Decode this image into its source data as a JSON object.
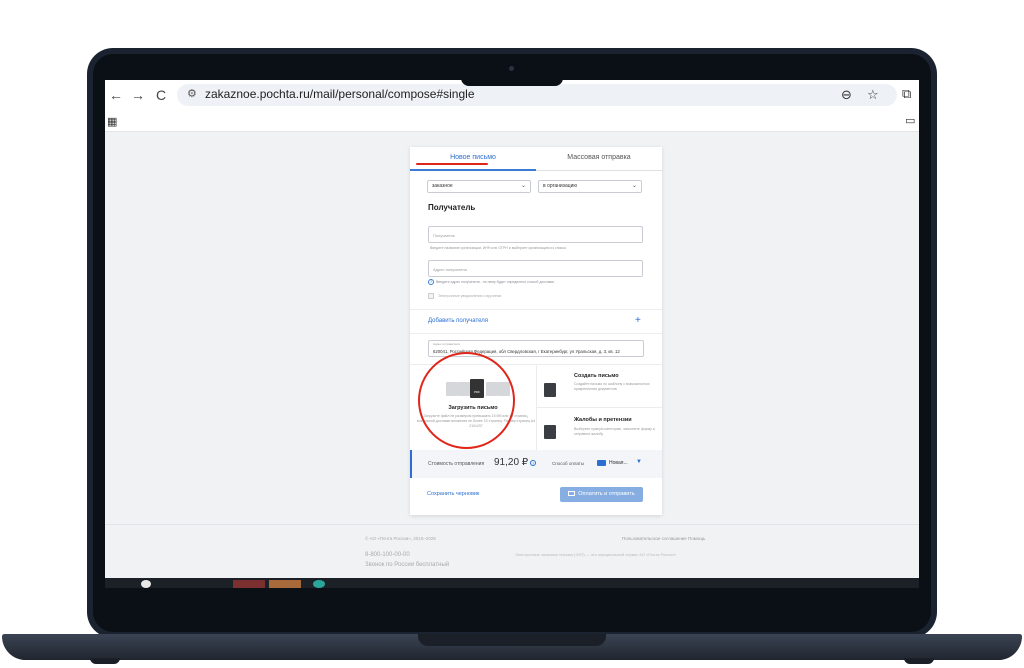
{
  "browser": {
    "url": "zakaznoe.pochta.ru/mail/personal/compose#single",
    "back_icon": "←",
    "forward_icon": "→",
    "reload_icon": "C",
    "zoom_icon": "⊖",
    "star_icon": "☆",
    "extension_icon": "⧉",
    "apps_icon": "▦",
    "folder_icon": "▭"
  },
  "tabs": {
    "single": "Новое письмо",
    "bulk": "Массовая отправка"
  },
  "form": {
    "letter_type": "заказное",
    "recipient_type": "в организацию",
    "recipient_heading": "Получатель",
    "recipient_placeholder": "Получатель",
    "recipient_hint": "Введите название организации, ИНН или ОГРН и выберите организацию из списка",
    "address_placeholder": "Адрес получателя",
    "address_hint": "Введите адрес получателя - по нему будет определено способ доставки",
    "address_hint_icon": "?",
    "email_notice_label": "Электронные уведомления о вручении",
    "add_recipient": "Добавить получателя",
    "add_plus": "+",
    "sender_label": "Адрес отправителя",
    "sender_value": "620041, Российская Федерация, обл Свердловская, г Екатеринбург, ул Уральская, д. 3, кв. 12"
  },
  "actions": {
    "upload_title": "Загрузить письмо",
    "upload_desc": "Загрузите файл не размером превышать 15 Мб или 15 страниц, возможной доставки вложения не более 15 страниц. Размер страниц А4 210х297",
    "pdf_label": "PDF",
    "create_title": "Создать письмо",
    "create_desc": "Создайте письмо по шаблону с возможностью прикрепления документов",
    "complaint_title": "Жалобы и претензии",
    "complaint_desc": "Выберите нужную категорию, заполните форму и отправьте жалобу"
  },
  "cost": {
    "label": "Стоимость отправления",
    "value": "91,20 ₽",
    "info_icon": "?",
    "payment_label": "Способ оплаты",
    "payment_value": "Новая...",
    "caret": "▼"
  },
  "bottom": {
    "save_draft": "Сохранить черновик",
    "submit": "Оплатить и отправить"
  },
  "footer": {
    "copyright": "© АО «Почта России», 2015–2025",
    "agreement": "Пользовательское соглашение",
    "help": "Помощь",
    "phone": "8-800-100-00-00",
    "phone_note": "Звонок по России бесплатный",
    "description": "Электронные заказные письма (ЭЗП) — это официальный сервис АО «Почта России»"
  },
  "colors": {
    "accent": "#2b6fd1",
    "annotation": "#e0261b"
  }
}
